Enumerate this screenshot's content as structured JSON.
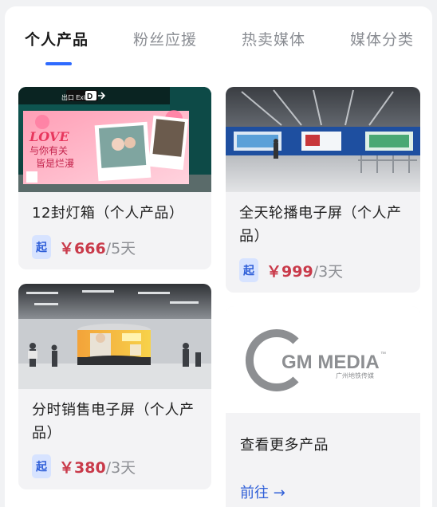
{
  "tabs": [
    {
      "label": "个人产品"
    },
    {
      "label": "粉丝应援"
    },
    {
      "label": "热卖媒体"
    },
    {
      "label": "媒体分类"
    }
  ],
  "products": [
    {
      "title": "12封灯箱（个人产品）",
      "badge": "起",
      "price": "￥666",
      "unit": "/5天",
      "image": {
        "sign_text": "出口 Exit",
        "sign_letter": "D",
        "love_text": "LOVE",
        "line1": "与你有关",
        "line2": "皆是烂漫"
      }
    },
    {
      "title": "全天轮播电子屏（个人产品）",
      "badge": "起",
      "price": "￥999",
      "unit": "/3天"
    },
    {
      "title": "分时销售电子屏（个人产品）",
      "badge": "起",
      "price": "￥380",
      "unit": "/3天"
    }
  ],
  "more": {
    "logo_text": "GM MEDIA",
    "logo_tm": "™",
    "logo_sub": "广州地铁传媒",
    "label": "查看更多产品",
    "link": "前往 →"
  },
  "colors": {
    "accent": "#2f6bff",
    "price": "#c93a4a",
    "badge_bg": "#d7e3ff"
  }
}
